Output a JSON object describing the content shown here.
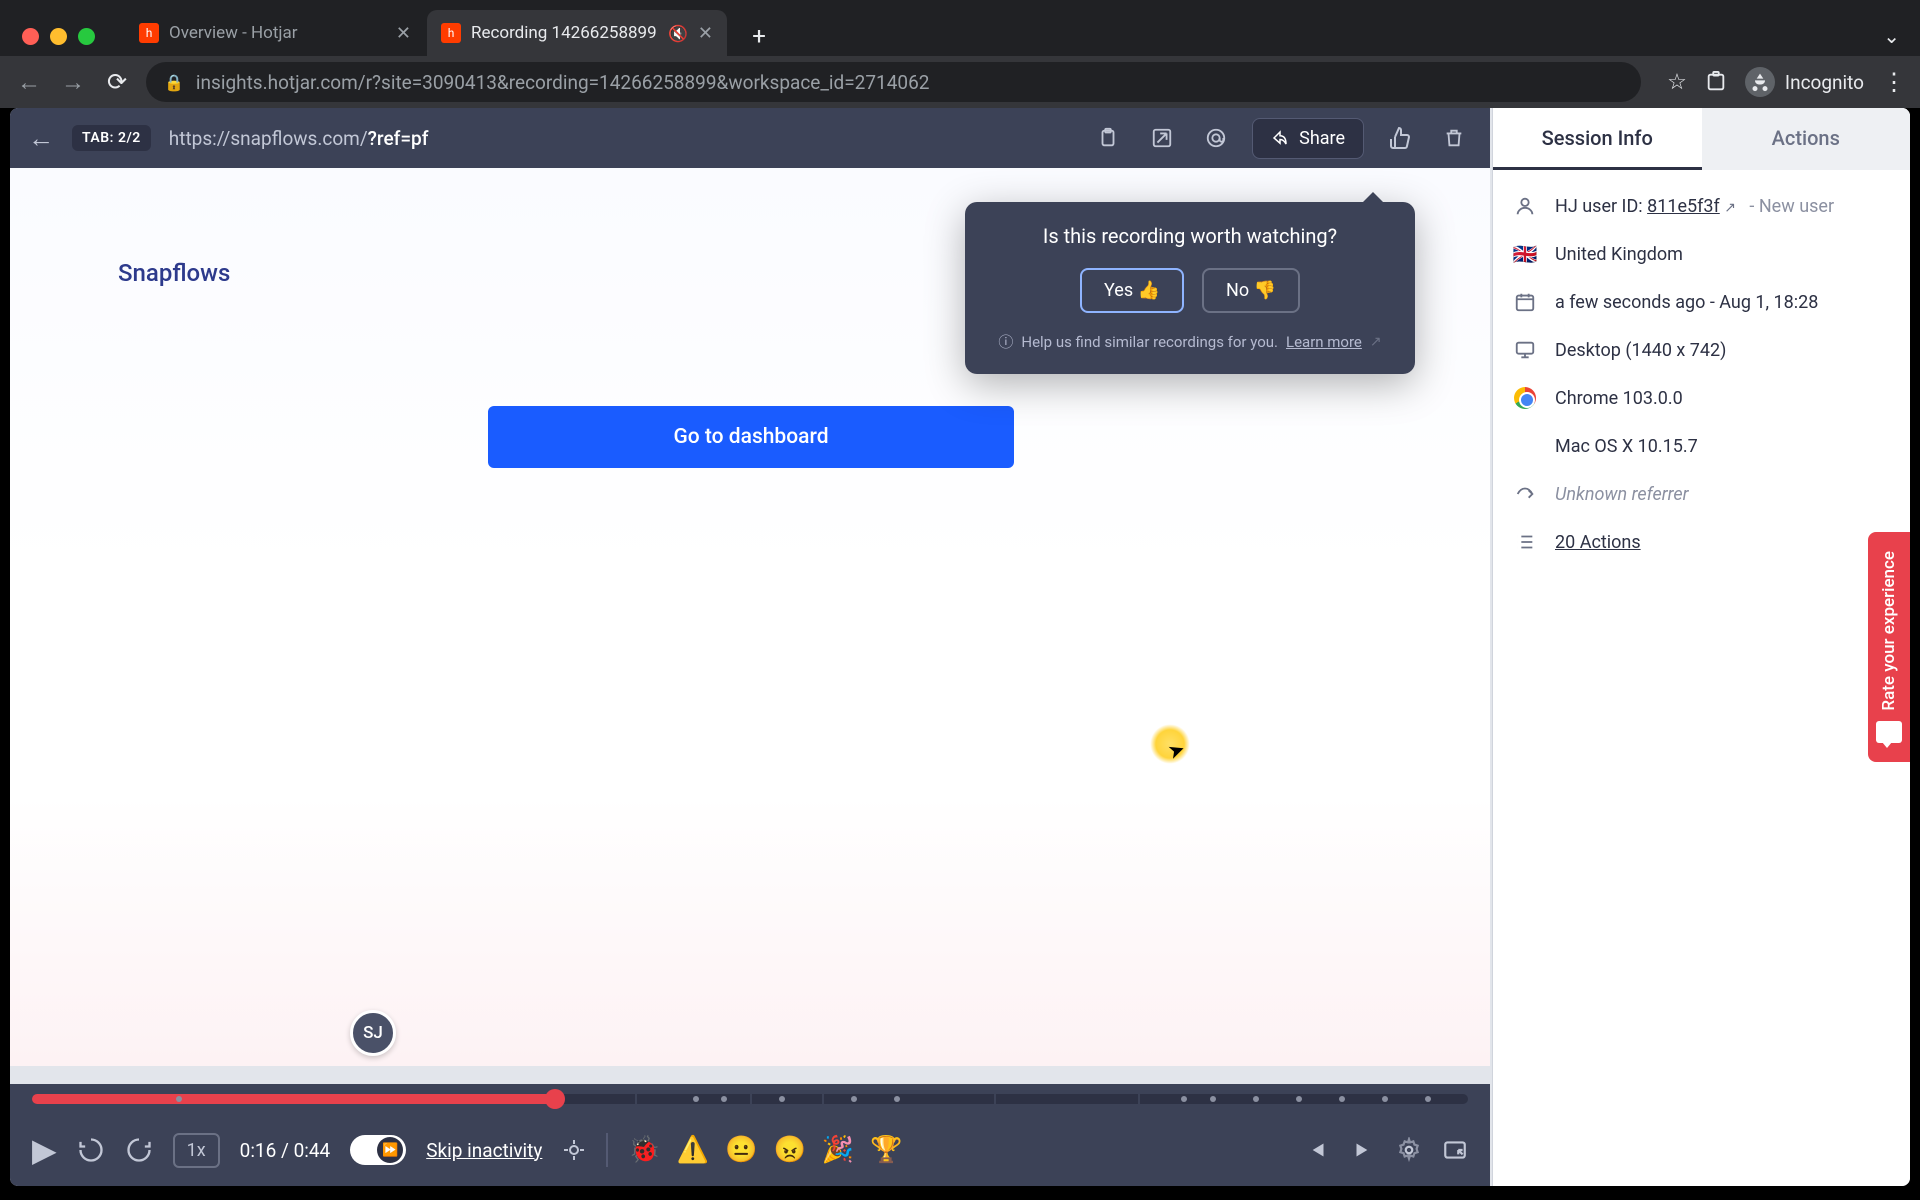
{
  "browser": {
    "tabs": [
      {
        "title": "Overview - Hotjar",
        "active": false
      },
      {
        "title": "Recording 14266258899",
        "active": true,
        "muted": true
      }
    ],
    "url_display": "insights.hotjar.com/r?site=3090413&recording=14266258899&workspace_id=2714062",
    "incognito_label": "Incognito"
  },
  "topbar": {
    "tab_badge": "TAB: 2/2",
    "page_url_prefix": "https://snapflows.com/",
    "page_url_bold": "?ref=pf",
    "share_label": "Share"
  },
  "callout": {
    "title": "Is this recording worth watching?",
    "yes": "Yes 👍",
    "no": "No 👎",
    "help_text": "Help us find similar recordings for you.",
    "learn_more": "Learn more"
  },
  "recording": {
    "brand": "Snapflows",
    "cta": "Go to dashboard",
    "avatar_initials": "SJ"
  },
  "controls": {
    "speed": "1x",
    "time_current": "0:16",
    "time_total": "0:44",
    "skip_label": "Skip inactivity",
    "emojis": [
      "🐞",
      "⚠️",
      "😐",
      "😠",
      "🎉",
      "🏆"
    ]
  },
  "side": {
    "tab_info": "Session Info",
    "tab_actions": "Actions",
    "user_label": "HJ user ID:",
    "user_id": "811e5f3f",
    "new_user": "- New user",
    "country": "United Kingdom",
    "time": "a few seconds ago - Aug 1, 18:28",
    "device": "Desktop (1440 x 742)",
    "browser": "Chrome 103.0.0",
    "os": "Mac OS X 10.15.7",
    "referrer": "Unknown referrer",
    "actions": "20 Actions"
  },
  "feedback_label": "Rate your experience"
}
